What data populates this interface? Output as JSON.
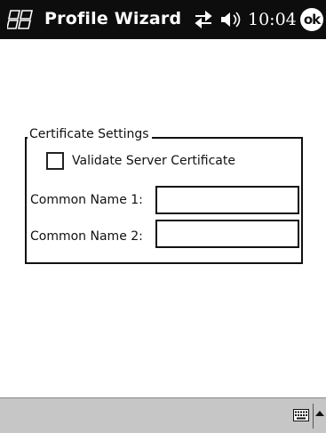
{
  "titlebar": {
    "title": "Profile Wizard",
    "clock": "10:04",
    "ok_label": "ok",
    "start_icon": "windows-flag-icon",
    "connectivity_icon": "connectivity-arrows-icon",
    "volume_icon": "speaker-icon"
  },
  "form": {
    "group_title": "Certificate Settings",
    "validate_label": "Validate Server Certificate",
    "validate_checked": false,
    "common_name_1_label": "Common Name 1:",
    "common_name_1_value": "",
    "common_name_2_label": "Common Name 2:",
    "common_name_2_value": ""
  },
  "taskbar": {
    "keyboard_icon": "keyboard-icon",
    "sip_arrow_icon": "up-arrow-icon"
  },
  "colors": {
    "titlebar_bg": "#0d0d0d",
    "taskbar_bg": "#c6c6c6",
    "content_bg": "#ffffff"
  }
}
